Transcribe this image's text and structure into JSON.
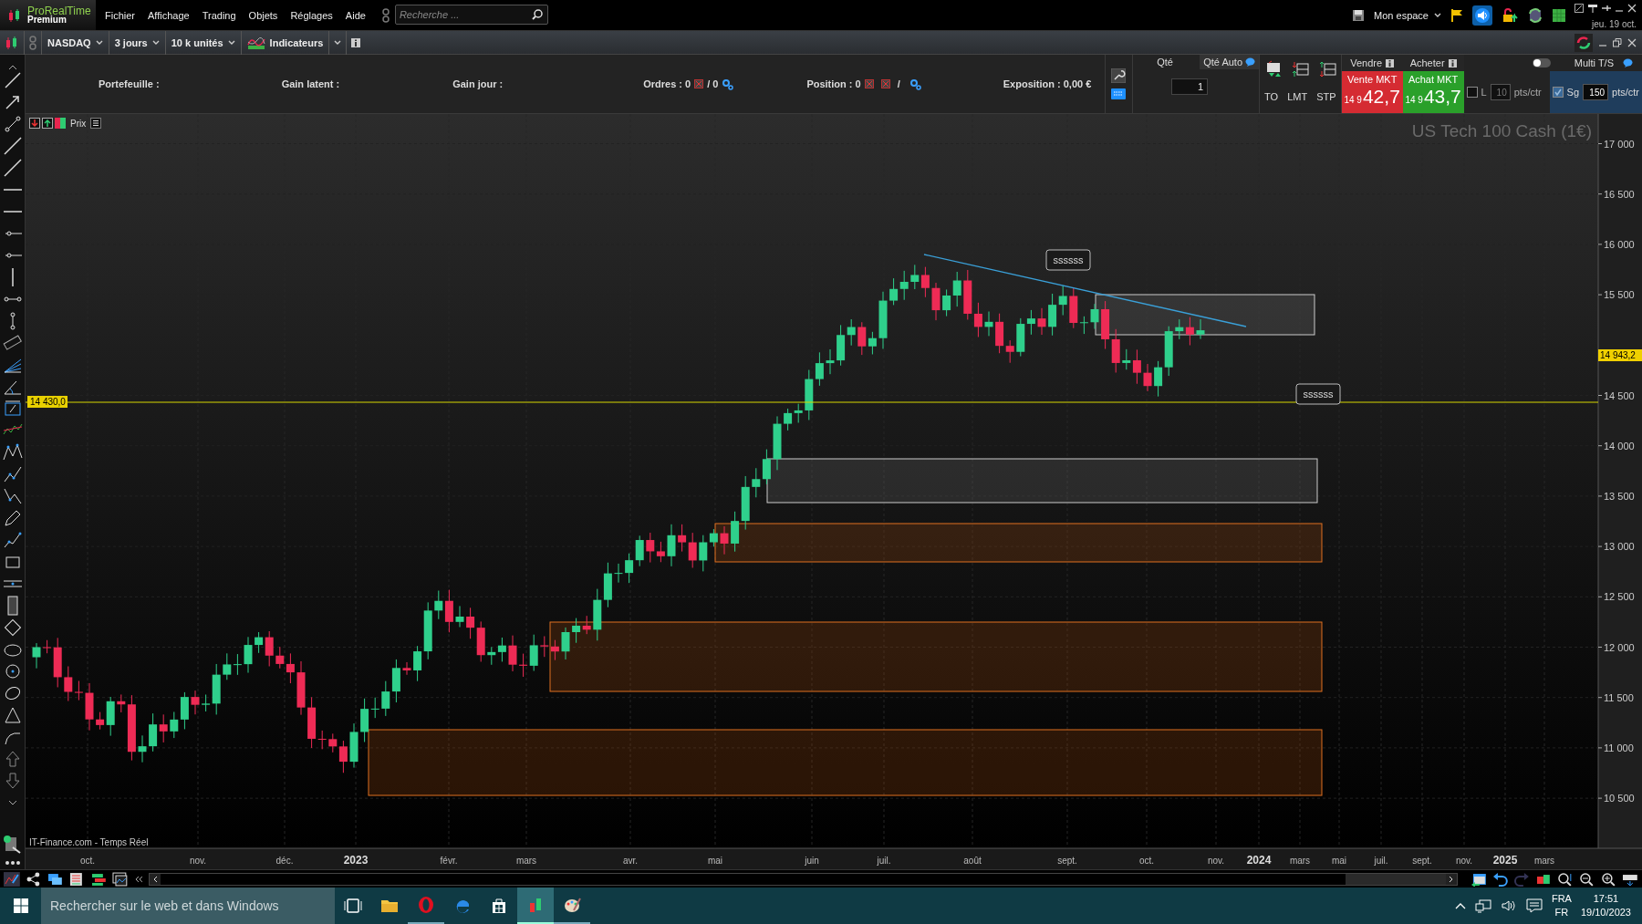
{
  "menubar": {
    "logo_title": "ProRealTime",
    "logo_subtitle": "Premium",
    "menus": [
      "Fichier",
      "Affichage",
      "Trading",
      "Objets",
      "Réglages",
      "Aide"
    ],
    "search": {
      "placeholder": "Recherche ..."
    },
    "workspace": "Mon espace",
    "date": "jeu. 19 oct."
  },
  "toolbar": {
    "instrument": "NASDAQ",
    "period": "3 jours",
    "units": "10 k unités",
    "indicators": "Indicateurs"
  },
  "trade_panel": {
    "portfolio": "Portefeuille :",
    "unrealized_gain": "Gain latent :",
    "day_gain": "Gain jour :",
    "orders_label": "Ordres : 0",
    "orders_count": "/ 0",
    "position_label": "Position : 0",
    "position_separator": "/",
    "exposure": "Exposition : 0,00 €",
    "quantity_label": "Qté",
    "quantity_auto": "Qté Auto",
    "quantity": "1",
    "order_types": [
      "TO",
      "LMT",
      "STP"
    ],
    "sell": {
      "header": "Vendre",
      "button": "Vente MKT",
      "price_prefix": "14 9",
      "price": "42,7"
    },
    "buy": {
      "header": "Acheter",
      "button": "Achat MKT",
      "price_prefix": "14 9",
      "price": "43,7"
    },
    "limit": {
      "label": "L",
      "checked": false,
      "value": "10",
      "unit": "pts/ctr"
    },
    "stop": {
      "label": "Sg",
      "checked": true,
      "value": "150",
      "unit": "pts/ctr"
    },
    "multi_ts": {
      "label": "Multi T/S",
      "on": false
    }
  },
  "chart": {
    "legend": "Prix",
    "title": "US Tech 100 Cash (1€)",
    "price_ticks": [
      "17 000",
      "16 500",
      "16 000",
      "15 500",
      "14 500",
      "14 000",
      "13 500",
      "13 000",
      "12 500",
      "12 000",
      "11 500",
      "11 000",
      "10 500"
    ],
    "current_price": "14 943,2",
    "level_line": "14 430,0",
    "labels": [
      "ssssss",
      "ssssss"
    ],
    "source": "IT-Finance.com - Temps Réel",
    "time_ticks": [
      {
        "label": "oct.",
        "year": false
      },
      {
        "label": "nov.",
        "year": false
      },
      {
        "label": "déc.",
        "year": false
      },
      {
        "label": "2023",
        "year": true
      },
      {
        "label": "févr.",
        "year": false
      },
      {
        "label": "mars",
        "year": false
      },
      {
        "label": "avr.",
        "year": false
      },
      {
        "label": "mai",
        "year": false
      },
      {
        "label": "juin",
        "year": false
      },
      {
        "label": "juil.",
        "year": false
      },
      {
        "label": "août",
        "year": false
      },
      {
        "label": "sept.",
        "year": false
      },
      {
        "label": "oct.",
        "year": false
      },
      {
        "label": "nov.",
        "year": false
      },
      {
        "label": "2024",
        "year": true
      },
      {
        "label": "mars",
        "year": false
      },
      {
        "label": "mai",
        "year": false
      },
      {
        "label": "juil.",
        "year": false
      },
      {
        "label": "sept.",
        "year": false
      },
      {
        "label": "nov.",
        "year": false
      },
      {
        "label": "2025",
        "year": true
      },
      {
        "label": "mars",
        "year": false
      }
    ]
  },
  "taskbar": {
    "search": {
      "placeholder": "Rechercher sur le web et dans Windows"
    },
    "language": "FRA",
    "layout": "FR",
    "time": "17:51",
    "date": "19/10/2023"
  }
}
